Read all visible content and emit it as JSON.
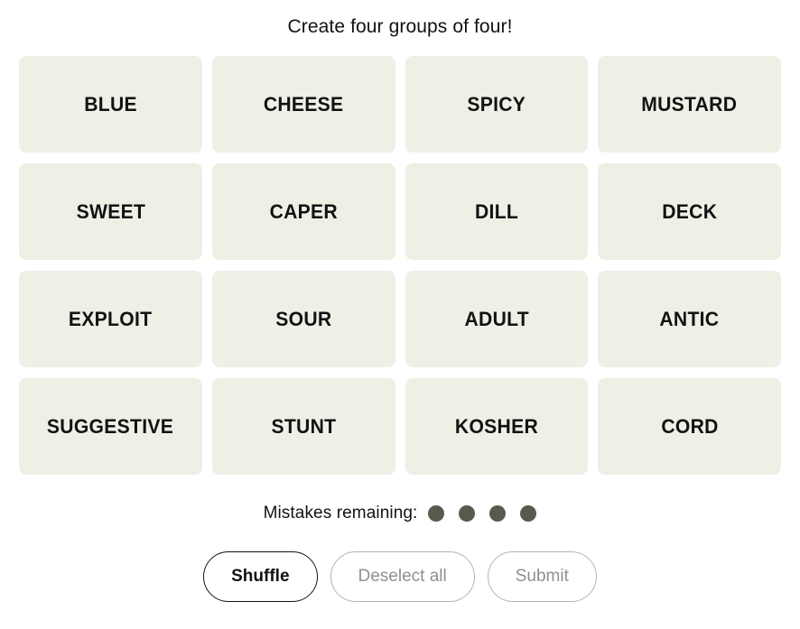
{
  "game": {
    "title": "Create four groups of four!",
    "tile_color": "#efefe6",
    "dot_color": "#5a594e",
    "text_color": "#121212",
    "disabled_color": "#8f8f8f",
    "background": "#ffffff"
  },
  "grid": {
    "rows": [
      [
        "BLUE",
        "CHEESE",
        "SPICY",
        "MUSTARD"
      ],
      [
        "SWEET",
        "CAPER",
        "DILL",
        "DECK"
      ],
      [
        "EXPLOIT",
        "SOUR",
        "ADULT",
        "ANTIC"
      ],
      [
        "SUGGESTIVE",
        "STUNT",
        "KOSHER",
        "CORD"
      ]
    ]
  },
  "mistakes": {
    "label": "Mistakes remaining:",
    "remaining": 4,
    "dots": [
      "filled",
      "filled",
      "filled",
      "filled"
    ]
  },
  "controls": {
    "shuffle": {
      "label": "Shuffle",
      "enabled": true
    },
    "deselect": {
      "label": "Deselect all",
      "enabled": false
    },
    "submit": {
      "label": "Submit",
      "enabled": false
    }
  }
}
